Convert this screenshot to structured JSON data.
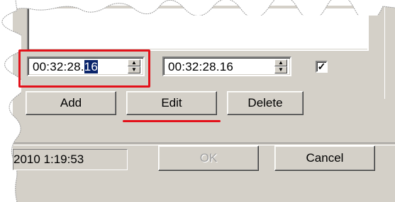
{
  "editor": {
    "start_time": {
      "text_before_selection": "00:32:28.",
      "selected_text": "16"
    },
    "end_time": {
      "value": "00:32:28.16"
    },
    "enabled_checkbox": {
      "checked": true,
      "mark": "✓"
    },
    "buttons": {
      "add": "Add",
      "edit": "Edit",
      "delete": "Delete"
    }
  },
  "footer": {
    "timestamp": "2010 1:19:53",
    "ok": "OK",
    "cancel": "Cancel"
  },
  "annotations": {
    "highlight_color": "#e3111a"
  }
}
